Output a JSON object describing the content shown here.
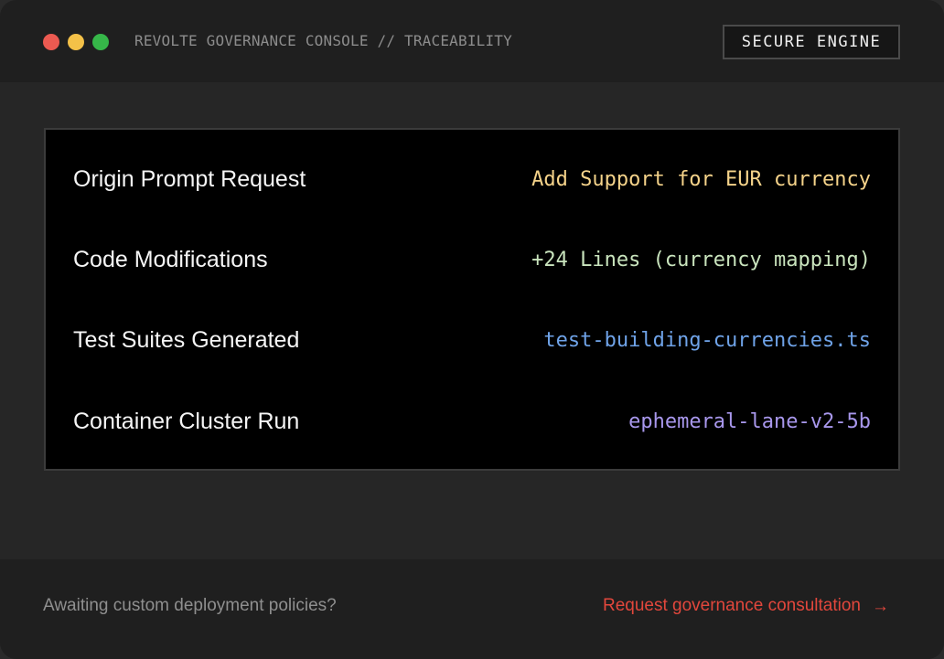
{
  "window": {
    "dots": [
      {
        "name": "close-dot",
        "color": "#ec5a51"
      },
      {
        "name": "minimize-dot",
        "color": "#f4c148"
      },
      {
        "name": "maximize-dot",
        "color": "#36b749"
      }
    ],
    "title": "REVOLTE GOVERNANCE CONSOLE // TRACEABILITY",
    "badge": "SECURE ENGINE"
  },
  "trace": {
    "rows": [
      {
        "label": "Origin Prompt Request",
        "value": "Add Support for EUR currency",
        "color": "#f5d38a"
      },
      {
        "label": "Code Modifications",
        "value": "+24 Lines (currency mapping)",
        "color": "#c9e4bd"
      },
      {
        "label": "Test Suites Generated",
        "value": "test-building-currencies.ts",
        "color": "#6fa3e8"
      },
      {
        "label": "Container Cluster Run",
        "value": "ephemeral-lane-v2-5b",
        "color": "#a897ec"
      }
    ]
  },
  "footer": {
    "note": "Awaiting custom deployment policies?",
    "cta_label": "Request governance consultation",
    "cta_icon": "arrow-right-icon",
    "cta_color": "#e2473c"
  }
}
